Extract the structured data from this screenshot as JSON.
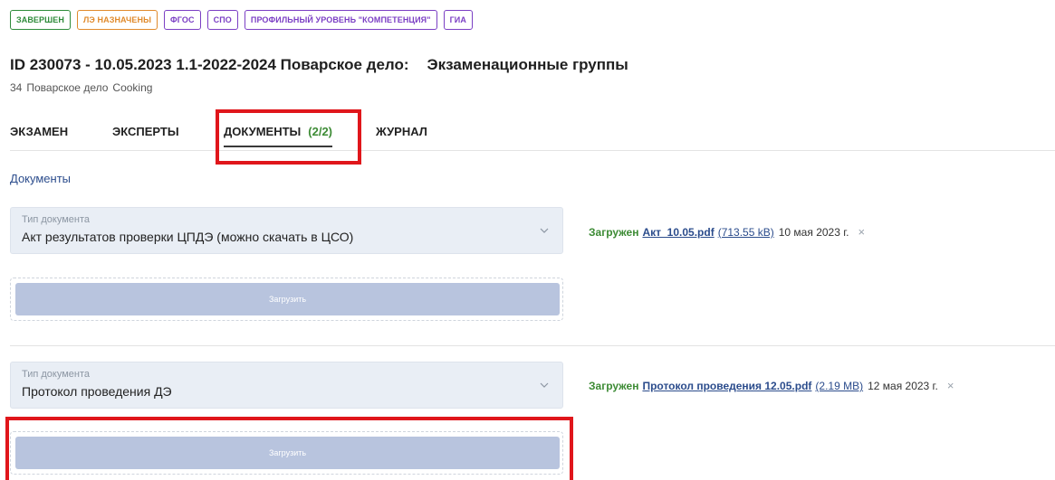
{
  "badges": [
    {
      "label": "ЗАВЕРШЕН",
      "color": "#2e8b3a"
    },
    {
      "label": "ЛЭ НАЗНАЧЕНЫ",
      "color": "#e08a2c"
    },
    {
      "label": "ФГОС",
      "color": "#7b3fc4"
    },
    {
      "label": "СПО",
      "color": "#7b3fc4"
    },
    {
      "label": "ПРОФИЛЬНЫЙ УРОВЕНЬ \"КОМПЕТЕНЦИЯ\"",
      "color": "#7b3fc4"
    },
    {
      "label": "ГИА",
      "color": "#7b3fc4"
    }
  ],
  "header": {
    "title": "ID 230073 - 10.05.2023 1.1-2022-2024 Поварское дело:",
    "title_suffix": "Экзаменационные группы",
    "subtitle_code": "34",
    "subtitle_ru": "Поварское дело",
    "subtitle_en": "Cooking"
  },
  "tabs": {
    "exam": "ЭКЗАМЕН",
    "experts": "ЭКСПЕРТЫ",
    "documents": "ДОКУМЕНТЫ",
    "documents_count": "(2/2)",
    "journal": "ЖУРНАЛ",
    "active": "documents"
  },
  "section_title": "Документы",
  "documents": [
    {
      "type_label": "Тип документа",
      "type_value": "Акт результатов проверки ЦПДЭ (можно скачать в ЦСО)",
      "upload_label": "Загрузить",
      "status": "Загружен",
      "file_name": "Акт_10.05.pdf",
      "file_size": "(713.55 kB)",
      "date": "10 мая 2023 г.",
      "remove": "×"
    },
    {
      "type_label": "Тип документа",
      "type_value": "Протокол проведения ДЭ",
      "upload_label": "Загрузить",
      "status": "Загружен",
      "file_name": "Протокол проведения 12.05.pdf",
      "file_size": "(2.19 MB)",
      "date": "12 мая 2023 г.",
      "remove": "×"
    }
  ],
  "colors": {
    "accent_green": "#3d8b35",
    "link_blue": "#2b4c8c",
    "upload_button": "#b8c4de",
    "highlight_red": "#e0161b"
  }
}
